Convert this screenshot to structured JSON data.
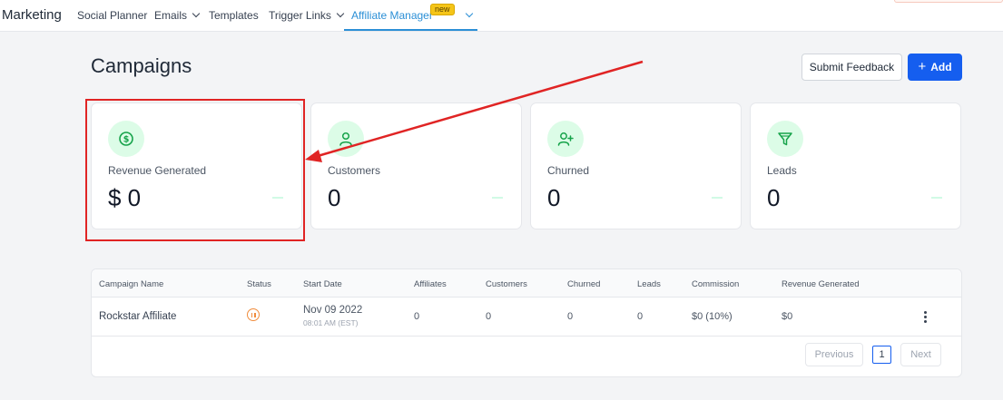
{
  "nav": {
    "brand": "Marketing",
    "items": [
      {
        "label": "Social Planner"
      },
      {
        "label": "Emails"
      },
      {
        "label": "Templates"
      },
      {
        "label": "Trigger Links"
      },
      {
        "label": "Affiliate Manager",
        "badge": "new"
      }
    ]
  },
  "header": {
    "title": "Campaigns",
    "feedback_label": "Submit Feedback",
    "add_label": "Add",
    "add_icon": "plus-icon"
  },
  "cards": [
    {
      "label": "Revenue Generated",
      "value": "$ 0",
      "icon": "dollar-icon"
    },
    {
      "label": "Customers",
      "value": "0",
      "icon": "user-icon"
    },
    {
      "label": "Churned",
      "value": "0",
      "icon": "user-plus-icon"
    },
    {
      "label": "Leads",
      "value": "0",
      "icon": "funnel-icon"
    }
  ],
  "table": {
    "columns": [
      "Campaign Name",
      "Status",
      "Start Date",
      "Affiliates",
      "Customers",
      "Churned",
      "Leads",
      "Commission",
      "Revenue Generated"
    ],
    "rows": [
      {
        "name": "Rockstar Affiliate",
        "status_icon": "pause-icon",
        "start_date": "Nov 09 2022",
        "start_time": "08:01 AM (EST)",
        "affiliates": "0",
        "customers": "0",
        "churned": "0",
        "leads": "0",
        "commission": "$0 (10%)",
        "revenue": "$0"
      }
    ]
  },
  "pagination": {
    "previous_label": "Previous",
    "current_page": "1",
    "next_label": "Next"
  },
  "colors": {
    "accent": "#155eef",
    "nav_active": "#2b8fd6",
    "icon_bg": "#dcfce7",
    "icon_fg": "#16a34a",
    "annotation": "#e02424",
    "status_paused": "#f08c3c"
  }
}
